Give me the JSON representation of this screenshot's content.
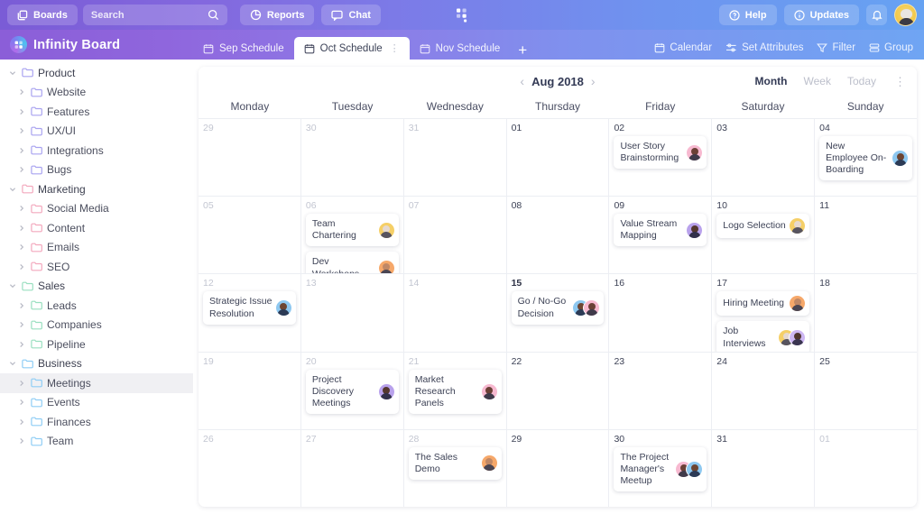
{
  "topbar": {
    "boards_label": "Boards",
    "search_placeholder": "Search",
    "reports_label": "Reports",
    "chat_label": "Chat",
    "help_label": "Help",
    "updates_label": "Updates",
    "icons": [
      "boards-icon",
      "search-icon",
      "reports-icon",
      "chat-icon",
      "help-icon",
      "updates-icon",
      "bell-icon",
      "app-logo-icon"
    ],
    "brand_gradient_start": "#7a5cd6",
    "brand_gradient_end": "#66a2f2"
  },
  "secondbar": {
    "brand_name": "Infinity Board",
    "tabs": [
      {
        "label": "Sep Schedule",
        "active": false
      },
      {
        "label": "Oct Schedule",
        "active": true,
        "menu": "⋮"
      },
      {
        "label": "Nov Schedule",
        "active": false
      }
    ],
    "add_tab_label": "+",
    "actions": [
      {
        "label": "Calendar",
        "icon": "calendar-icon"
      },
      {
        "label": "Set Attributes",
        "icon": "attributes-icon"
      },
      {
        "label": "Filter",
        "icon": "filter-icon"
      },
      {
        "label": "Group",
        "icon": "group-icon"
      }
    ]
  },
  "sidebar": {
    "items": [
      {
        "label": "Product",
        "level": 0,
        "expanded": true,
        "color": "#a9a3f0",
        "selected": false
      },
      {
        "label": "Website",
        "level": 1,
        "expanded": false,
        "color": "#a9a3f0",
        "selected": false
      },
      {
        "label": "Features",
        "level": 1,
        "expanded": false,
        "color": "#a9a3f0",
        "selected": false
      },
      {
        "label": "UX/UI",
        "level": 1,
        "expanded": false,
        "color": "#a9a3f0",
        "selected": false
      },
      {
        "label": "Integrations",
        "level": 1,
        "expanded": false,
        "color": "#a9a3f0",
        "selected": false
      },
      {
        "label": "Bugs",
        "level": 1,
        "expanded": false,
        "color": "#a9a3f0",
        "selected": false
      },
      {
        "label": "Marketing",
        "level": 0,
        "expanded": true,
        "color": "#f3a8bd",
        "selected": false
      },
      {
        "label": "Social Media",
        "level": 1,
        "expanded": false,
        "color": "#f3a8bd",
        "selected": false
      },
      {
        "label": "Content",
        "level": 1,
        "expanded": false,
        "color": "#f3a8bd",
        "selected": false
      },
      {
        "label": "Emails",
        "level": 1,
        "expanded": false,
        "color": "#f3a8bd",
        "selected": false
      },
      {
        "label": "SEO",
        "level": 1,
        "expanded": false,
        "color": "#f3a8bd",
        "selected": false
      },
      {
        "label": "Sales",
        "level": 0,
        "expanded": true,
        "color": "#9adfc0",
        "selected": false
      },
      {
        "label": "Leads",
        "level": 1,
        "expanded": false,
        "color": "#9adfc0",
        "selected": false
      },
      {
        "label": "Companies",
        "level": 1,
        "expanded": false,
        "color": "#9adfc0",
        "selected": false
      },
      {
        "label": "Pipeline",
        "level": 1,
        "expanded": false,
        "color": "#9adfc0",
        "selected": false
      },
      {
        "label": "Business",
        "level": 0,
        "expanded": true,
        "color": "#8fcdf5",
        "selected": false
      },
      {
        "label": "Meetings",
        "level": 1,
        "expanded": false,
        "color": "#8fcdf5",
        "selected": true
      },
      {
        "label": "Events",
        "level": 1,
        "expanded": false,
        "color": "#8fcdf5",
        "selected": false
      },
      {
        "label": "Finances",
        "level": 1,
        "expanded": false,
        "color": "#8fcdf5",
        "selected": false
      },
      {
        "label": "Team",
        "level": 1,
        "expanded": false,
        "color": "#8fcdf5",
        "selected": false
      }
    ]
  },
  "calendar": {
    "month_label": "Aug 2018",
    "prev_label": "‹",
    "next_label": "›",
    "views": [
      {
        "label": "Month",
        "active": true
      },
      {
        "label": "Week",
        "active": false
      },
      {
        "label": "Today",
        "active": false
      }
    ],
    "kebab_label": "⋮",
    "weekday_headers": [
      "Monday",
      "Tuesday",
      "Wednesday",
      "Thursday",
      "Friday",
      "Saturday",
      "Sunday"
    ],
    "weeks": [
      [
        {
          "date": "29",
          "muted": true,
          "today": false,
          "events": []
        },
        {
          "date": "30",
          "muted": true,
          "today": false,
          "events": []
        },
        {
          "date": "31",
          "muted": true,
          "today": false,
          "events": []
        },
        {
          "date": "01",
          "muted": false,
          "today": false,
          "events": []
        },
        {
          "date": "02",
          "muted": false,
          "today": false,
          "events": [
            {
              "title": "User Story Brainstorming",
              "avatars": [
                "a-pink"
              ]
            }
          ]
        },
        {
          "date": "03",
          "muted": false,
          "today": false,
          "events": []
        },
        {
          "date": "04",
          "muted": false,
          "today": false,
          "events": [
            {
              "title": "New Employee On-Boarding",
              "avatars": [
                "a-blue"
              ]
            }
          ]
        }
      ],
      [
        {
          "date": "05",
          "muted": true,
          "today": false,
          "events": []
        },
        {
          "date": "06",
          "muted": true,
          "today": false,
          "events": [
            {
              "title": "Team Chartering",
              "avatars": [
                "a-yellow"
              ]
            },
            {
              "title": "Dev Workshops",
              "avatars": [
                "a-orange"
              ]
            }
          ]
        },
        {
          "date": "07",
          "muted": true,
          "today": false,
          "events": []
        },
        {
          "date": "08",
          "muted": false,
          "today": false,
          "events": []
        },
        {
          "date": "09",
          "muted": false,
          "today": false,
          "events": [
            {
              "title": "Value Stream Mapping",
              "avatars": [
                "a-purple"
              ]
            }
          ]
        },
        {
          "date": "10",
          "muted": false,
          "today": false,
          "events": [
            {
              "title": "Logo Selection",
              "avatars": [
                "a-yellow"
              ]
            }
          ]
        },
        {
          "date": "11",
          "muted": false,
          "today": false,
          "events": []
        }
      ],
      [
        {
          "date": "12",
          "muted": true,
          "today": false,
          "events": [
            {
              "title": "Strategic Issue Resolution",
              "avatars": [
                "a-blue"
              ]
            }
          ]
        },
        {
          "date": "13",
          "muted": true,
          "today": false,
          "events": []
        },
        {
          "date": "14",
          "muted": true,
          "today": false,
          "events": []
        },
        {
          "date": "15",
          "muted": false,
          "today": true,
          "events": [
            {
              "title": "Go / No-Go Decision",
              "avatars": [
                "a-blue",
                "a-pink"
              ]
            }
          ]
        },
        {
          "date": "16",
          "muted": false,
          "today": false,
          "events": []
        },
        {
          "date": "17",
          "muted": false,
          "today": false,
          "events": [
            {
              "title": "Hiring Meeting",
              "avatars": [
                "a-orange"
              ]
            },
            {
              "title": "Job Interviews",
              "avatars": [
                "a-yellow",
                "a-lilac"
              ]
            }
          ]
        },
        {
          "date": "18",
          "muted": false,
          "today": false,
          "events": []
        }
      ],
      [
        {
          "date": "19",
          "muted": true,
          "today": false,
          "events": []
        },
        {
          "date": "20",
          "muted": true,
          "today": false,
          "events": [
            {
              "title": "Project Discovery Meetings",
              "avatars": [
                "a-purple"
              ]
            }
          ]
        },
        {
          "date": "21",
          "muted": true,
          "today": false,
          "events": [
            {
              "title": "Market Research Panels",
              "avatars": [
                "a-pink"
              ]
            }
          ]
        },
        {
          "date": "22",
          "muted": false,
          "today": false,
          "events": []
        },
        {
          "date": "23",
          "muted": false,
          "today": false,
          "events": []
        },
        {
          "date": "24",
          "muted": false,
          "today": false,
          "events": []
        },
        {
          "date": "25",
          "muted": false,
          "today": false,
          "events": []
        }
      ],
      [
        {
          "date": "26",
          "muted": true,
          "today": false,
          "events": []
        },
        {
          "date": "27",
          "muted": true,
          "today": false,
          "events": []
        },
        {
          "date": "28",
          "muted": true,
          "today": false,
          "events": [
            {
              "title": "The Sales Demo",
              "avatars": [
                "a-orange"
              ]
            }
          ]
        },
        {
          "date": "29",
          "muted": false,
          "today": false,
          "events": []
        },
        {
          "date": "30",
          "muted": false,
          "today": false,
          "events": [
            {
              "title": "The Project Manager's Meetup",
              "avatars": [
                "a-pink",
                "a-blue"
              ]
            }
          ]
        },
        {
          "date": "31",
          "muted": false,
          "today": false,
          "events": []
        },
        {
          "date": "01",
          "muted": true,
          "today": false,
          "events": []
        }
      ]
    ]
  }
}
